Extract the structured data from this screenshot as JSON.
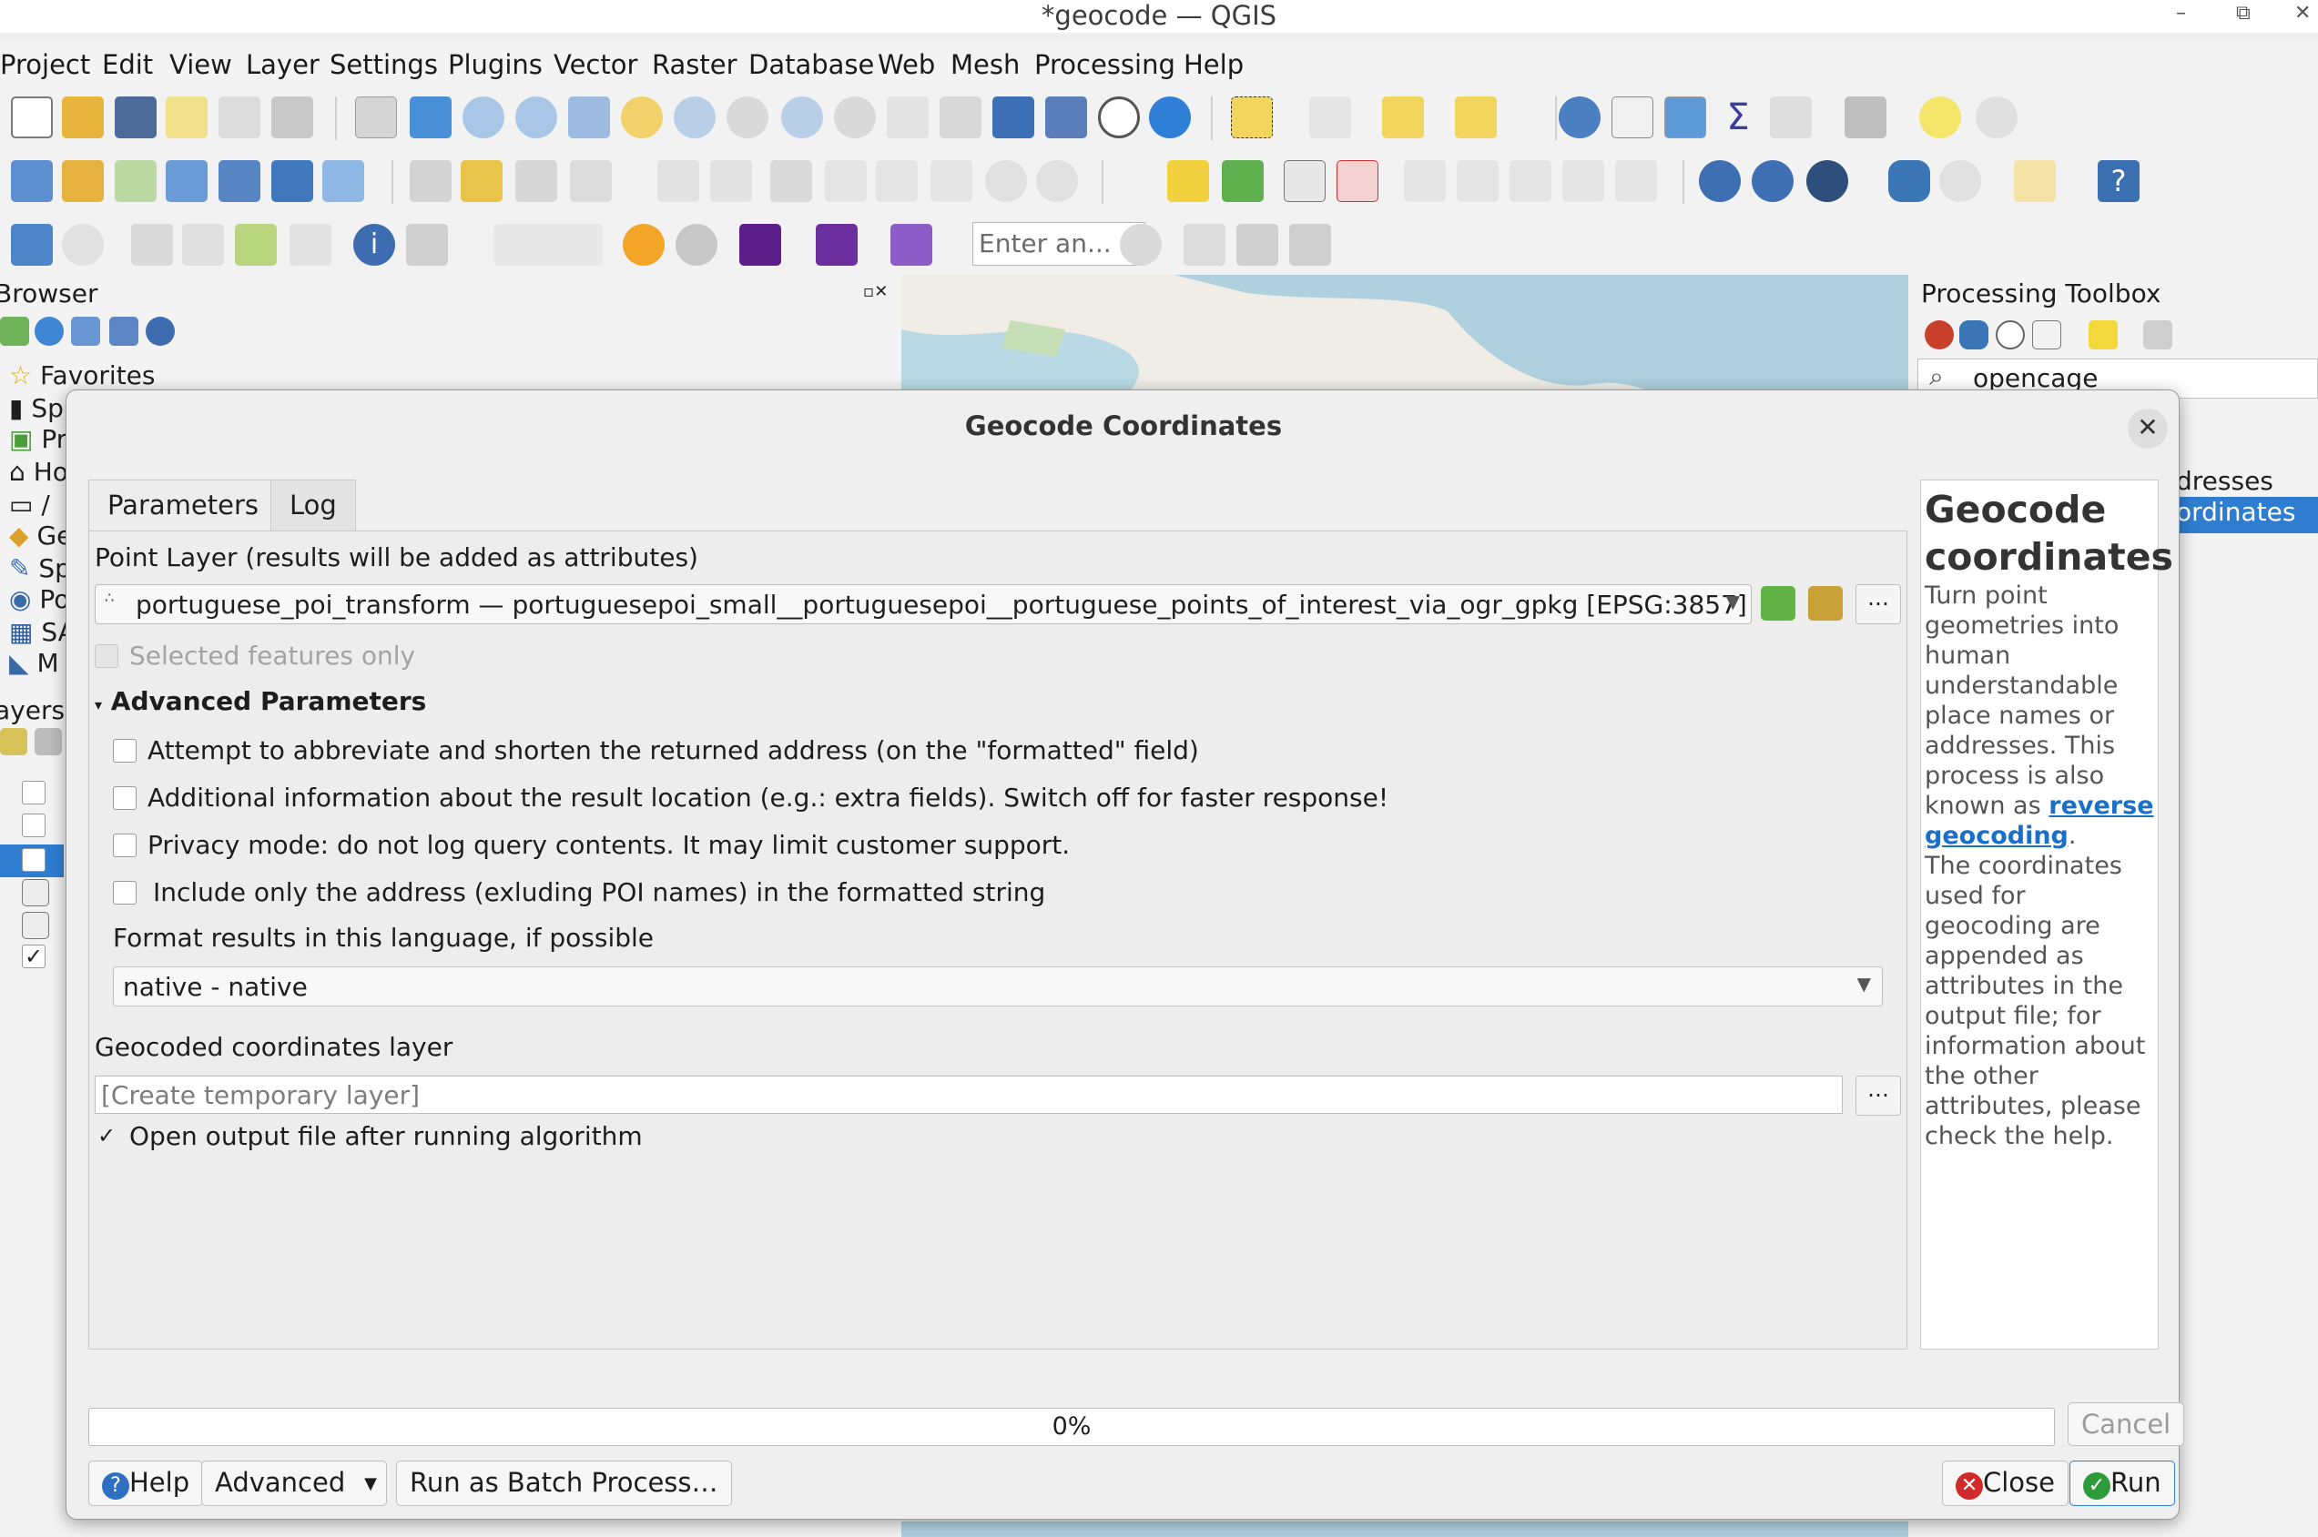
{
  "window": {
    "title": "*geocode — QGIS"
  },
  "menu": [
    "Project",
    "Edit",
    "View",
    "Layer",
    "Settings",
    "Plugins",
    "Vector",
    "Raster",
    "Database",
    "Web",
    "Mesh",
    "Processing",
    "Help"
  ],
  "toolbar": {
    "search_placeholder": "Enter an..."
  },
  "browser": {
    "title": "Browser",
    "items": [
      "Favorites",
      "Sp",
      "Pr",
      "Ho",
      "/",
      "Ge",
      "Sp",
      "Po",
      "SA",
      "M"
    ]
  },
  "layers": {
    "title": "ayers"
  },
  "toolbox": {
    "title": "Processing Toolbox",
    "search_value": "opencage",
    "results": [
      "dresses",
      "ordinates"
    ]
  },
  "dialog": {
    "title": "Geocode Coordinates",
    "tabs": [
      "Parameters",
      "Log"
    ],
    "point_layer_label": "Point Layer (results will be added as attributes)",
    "point_layer_value": "portuguese_poi_transform — portuguesepoi_small__portuguesepoi__portuguese_points_of_interest_via_ogr_gpkg [EPSG:3857]",
    "selected_only": "Selected features only",
    "advanced_header": "Advanced Parameters",
    "options": [
      "Attempt to abbreviate and shorten the returned address (on the \"formatted\" field)",
      "Additional information about the result location (e.g.: extra fields). Switch off for faster response!",
      "Privacy mode: do not log query contents. It may limit customer support.",
      "Include only the address (exluding POI names) in the formatted string"
    ],
    "language_label": "Format results in this language, if possible",
    "language_value": "native - native",
    "output_label": "Geocoded coordinates layer",
    "output_placeholder": "[Create temporary layer]",
    "open_output": "Open output file after running algorithm",
    "dots": "…",
    "progress": "0%",
    "buttons": {
      "help": "Help",
      "advanced": "Advanced",
      "batch": "Run as Batch Process…",
      "cancel": "Cancel",
      "close": "Close",
      "run": "Run"
    }
  },
  "help": {
    "heading": "Geocode coordinates",
    "text1": "Turn point geometries into human understandable place names or addresses. This process is also known as",
    "link": "reverse geocoding",
    "text2": ".",
    "text3": "The coordinates used for geocoding are appended as attributes in the output file; for information about the other attributes, please check the help."
  }
}
